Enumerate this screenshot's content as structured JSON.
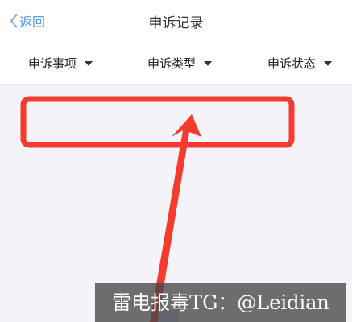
{
  "nav": {
    "back_label": "返回",
    "title": "申诉记录"
  },
  "filters": [
    {
      "label": "申诉事项"
    },
    {
      "label": "申诉类型"
    },
    {
      "label": "申诉状态"
    }
  ],
  "watermark": {
    "text": "雷电报毒TG：@Leidian"
  },
  "colors": {
    "accent_link": "#5d9be6",
    "annotation_red": "#f53b2f",
    "background": "#f3f3f8"
  },
  "icons": {
    "back": "chevron-left-icon",
    "caret": "caret-down-icon",
    "annotation": "arrow-up-icon"
  }
}
